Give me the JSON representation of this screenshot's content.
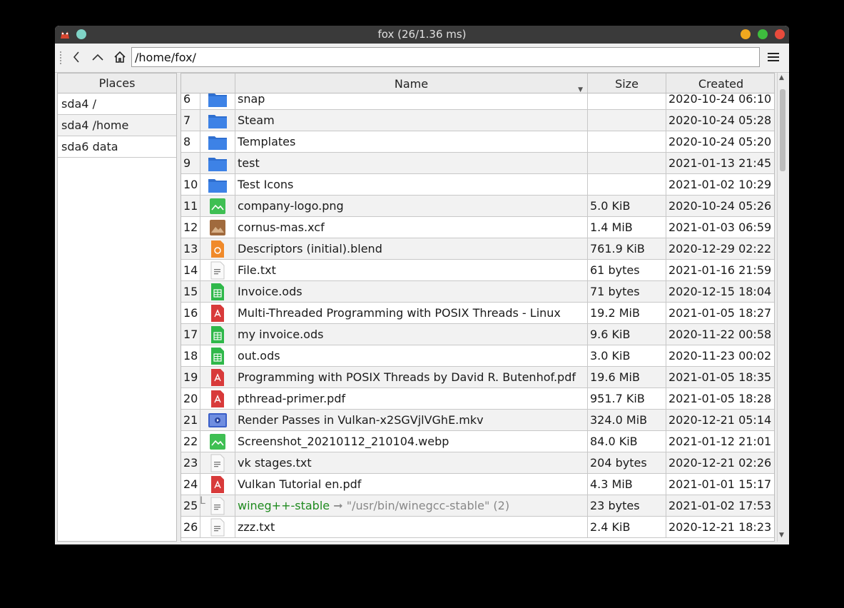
{
  "window": {
    "title": "fox (26/1.36 ms)",
    "colors": {
      "titlebar": "#3a3a3a",
      "sticky": "#7fd3c6",
      "minimize": "#f0a81e",
      "maximize": "#3ebd3e",
      "close": "#e84b3c"
    }
  },
  "toolbar": {
    "path_value": "/home/fox/",
    "icons": [
      "back-arrow-icon",
      "up-arrow-icon",
      "home-icon",
      "hamburger-menu-icon"
    ]
  },
  "places": {
    "header": "Places",
    "items": [
      {
        "label": "sda4 /"
      },
      {
        "label": "sda4 /home"
      },
      {
        "label": "sda6 data"
      }
    ]
  },
  "table": {
    "columns": {
      "name": "Name",
      "size": "Size",
      "created": "Created"
    },
    "rows": [
      {
        "num": "6",
        "icon": "folder",
        "name": "snap",
        "size": "",
        "date": "2020-10-24 06:10"
      },
      {
        "num": "7",
        "icon": "folder",
        "name": "Steam",
        "size": "",
        "date": "2020-10-24 05:28"
      },
      {
        "num": "8",
        "icon": "folder",
        "name": "Templates",
        "size": "",
        "date": "2020-10-24 05:20"
      },
      {
        "num": "9",
        "icon": "folder",
        "name": "test",
        "size": "",
        "date": "2021-01-13 21:45"
      },
      {
        "num": "10",
        "icon": "folder",
        "name": "Test Icons",
        "size": "",
        "date": "2021-01-02 10:29"
      },
      {
        "num": "11",
        "icon": "image",
        "name": "company-logo.png",
        "size": "5.0 KiB",
        "date": "2020-10-24 05:26"
      },
      {
        "num": "12",
        "icon": "xcf",
        "name": "cornus-mas.xcf",
        "size": "1.4 MiB",
        "date": "2021-01-03 06:59"
      },
      {
        "num": "13",
        "icon": "blend",
        "name": "Descriptors (initial).blend",
        "size": "761.9 KiB",
        "date": "2020-12-29 02:22"
      },
      {
        "num": "14",
        "icon": "text",
        "name": "File.txt",
        "size": "61 bytes",
        "date": "2021-01-16 21:59"
      },
      {
        "num": "15",
        "icon": "sheet",
        "name": "Invoice.ods",
        "size": "71 bytes",
        "date": "2020-12-15 18:04"
      },
      {
        "num": "16",
        "icon": "pdf",
        "name": "Multi-Threaded Programming with POSIX Threads - Linux",
        "size": "19.2 MiB",
        "date": "2021-01-05 18:27"
      },
      {
        "num": "17",
        "icon": "sheet",
        "name": "my invoice.ods",
        "size": "9.6 KiB",
        "date": "2020-11-22 00:58"
      },
      {
        "num": "18",
        "icon": "sheet",
        "name": "out.ods",
        "size": "3.0 KiB",
        "date": "2020-11-23 00:02"
      },
      {
        "num": "19",
        "icon": "pdf",
        "name": "Programming with POSIX Threads by David R. Butenhof.pdf",
        "size": "19.6 MiB",
        "date": "2021-01-05 18:35"
      },
      {
        "num": "20",
        "icon": "pdf",
        "name": "pthread-primer.pdf",
        "size": "951.7 KiB",
        "date": "2021-01-05 18:28"
      },
      {
        "num": "21",
        "icon": "video",
        "name": "Render Passes in Vulkan-x2SGVjlVGhE.mkv",
        "size": "324.0 MiB",
        "date": "2020-12-21 05:14"
      },
      {
        "num": "22",
        "icon": "image",
        "name": "Screenshot_20210112_210104.webp",
        "size": "84.0 KiB",
        "date": "2021-01-12 21:01"
      },
      {
        "num": "23",
        "icon": "text",
        "name": "vk stages.txt",
        "size": "204 bytes",
        "date": "2020-12-21 02:26"
      },
      {
        "num": "24",
        "icon": "pdf",
        "name": "Vulkan Tutorial en.pdf",
        "size": "4.3 MiB",
        "date": "2021-01-01 15:17"
      },
      {
        "num": "25",
        "icon": "text",
        "name": "wineg++-stable",
        "size": "23 bytes",
        "date": "2021-01-02 17:53",
        "link": {
          "marker": "L",
          "arrow": "➞",
          "target": "\"/usr/bin/winegcc-stable\" (2)"
        }
      },
      {
        "num": "26",
        "icon": "text",
        "name": "zzz.txt",
        "size": "2.4 KiB",
        "date": "2020-12-21 18:23"
      }
    ]
  }
}
